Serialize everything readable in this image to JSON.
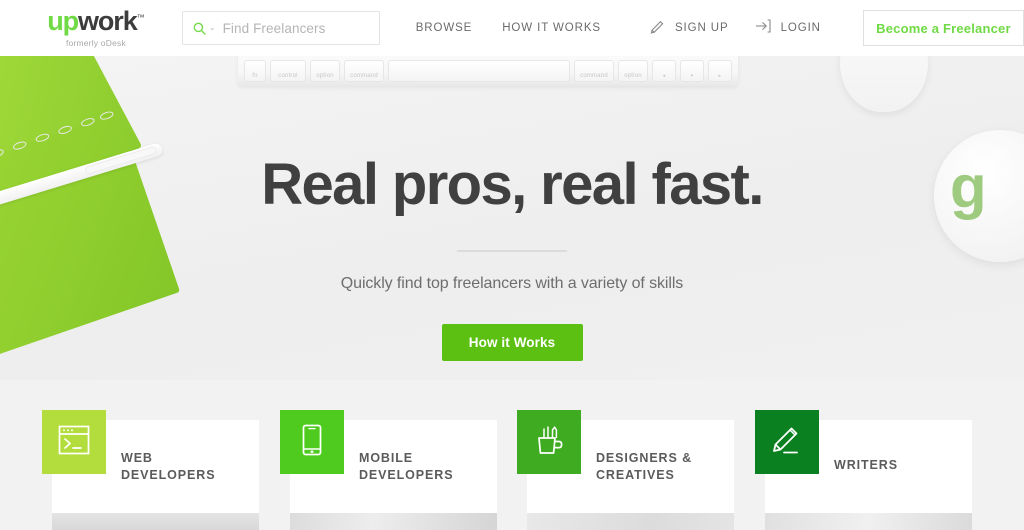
{
  "header": {
    "logo": {
      "prefix": "up",
      "suffix": "work",
      "tm": "™",
      "tagline": "formerly oDesk"
    },
    "search": {
      "placeholder": "Find Freelancers",
      "icon": "search-icon",
      "caret": "⌄"
    },
    "nav": [
      {
        "label": "BROWSE"
      },
      {
        "label": "HOW IT WORKS"
      }
    ],
    "account": [
      {
        "label": "SIGN UP",
        "icon": "pencil-icon"
      },
      {
        "label": "LOGIN",
        "icon": "login-arrow-icon"
      }
    ],
    "cta": {
      "label": "Become a Freelancer",
      "color": "#6fda44"
    }
  },
  "hero": {
    "title": "Real pros, real fast.",
    "subtitle": "Quickly find top freelancers with a variety of skills",
    "cta": {
      "label": "How it Works",
      "color": "#5cc012"
    },
    "keyboard_keys": [
      {
        "label": "fn"
      },
      {
        "label": "control"
      },
      {
        "label": "option"
      },
      {
        "label": "command"
      },
      {
        "label": ""
      },
      {
        "label": "command"
      },
      {
        "label": "option"
      },
      {
        "label": "◂"
      },
      {
        "label": "▾"
      },
      {
        "label": "▸"
      }
    ],
    "mug_mark": "g"
  },
  "categories": [
    {
      "line1": "WEB",
      "line2": "DEVELOPERS",
      "icon": "code-window-icon",
      "color": "#b3dd3c"
    },
    {
      "line1": "MOBILE",
      "line2": "DEVELOPERS",
      "icon": "smartphone-icon",
      "color": "#4ecb1e"
    },
    {
      "line1": "DESIGNERS &",
      "line2": "CREATIVES",
      "icon": "pencil-cup-icon",
      "color": "#3fab21"
    },
    {
      "line1": "WRITERS",
      "line2": "",
      "icon": "pencil-icon",
      "color": "#0a8020"
    }
  ]
}
